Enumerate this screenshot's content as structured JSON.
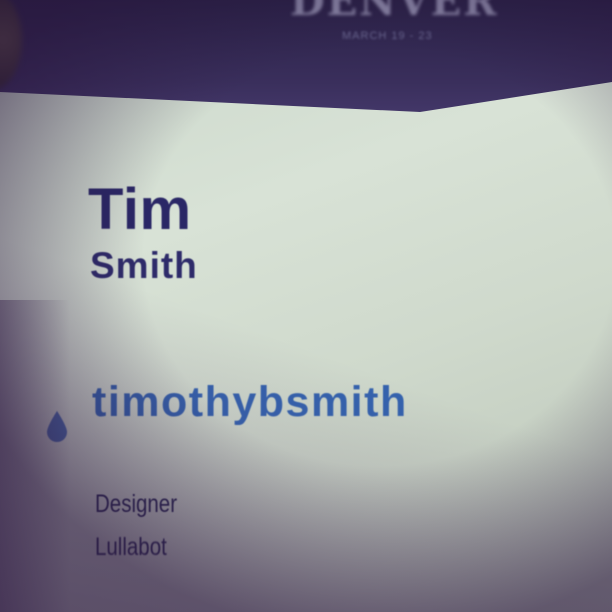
{
  "badge": {
    "event_city": "DENVER",
    "event_dates": "MARCH 19 - 23",
    "first_name": "Tim",
    "last_name": "Smith",
    "handle": "timothybsmith",
    "handle_icon": "drop-icon",
    "role": "Designer",
    "company": "Lullabot"
  },
  "colors": {
    "header": "#2a2146",
    "card": "#d2ddd0",
    "name": "#2a2766",
    "handle": "#3563ae",
    "drop": "#4a6fae"
  }
}
